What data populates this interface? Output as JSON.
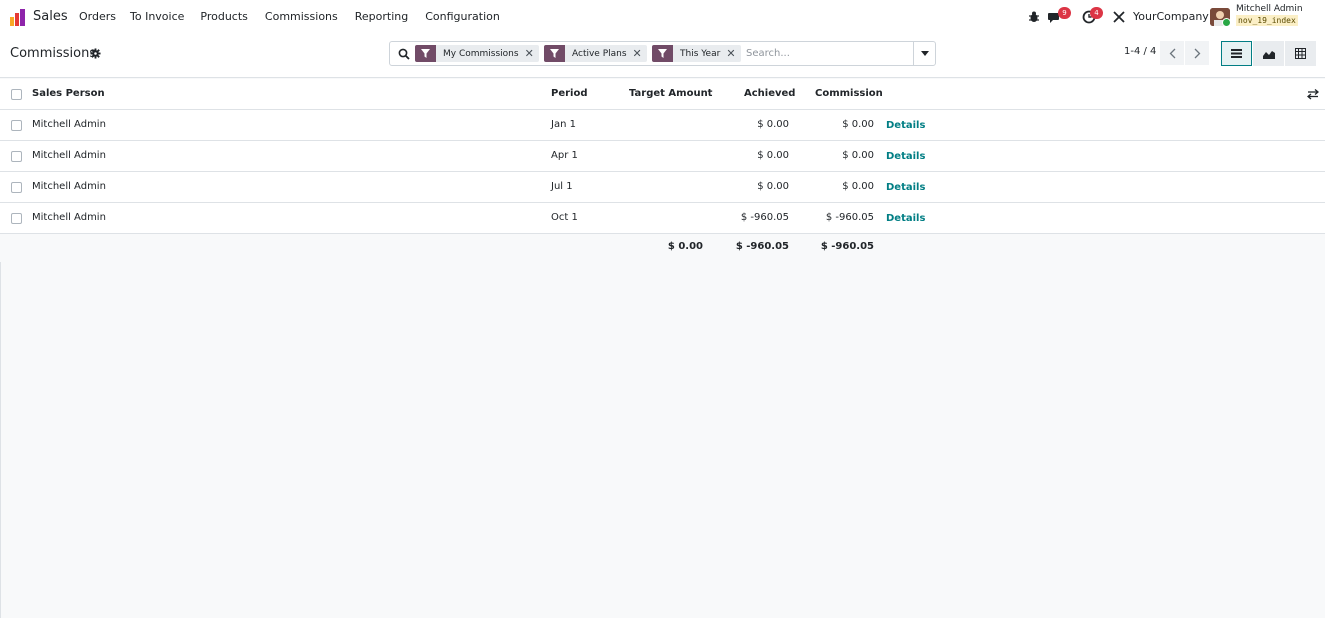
{
  "navbar": {
    "app_name": "Sales",
    "menu": [
      "Orders",
      "To Invoice",
      "Products",
      "Commissions",
      "Reporting",
      "Configuration"
    ],
    "messages_count": "9",
    "activities_count": "4",
    "company": "YourCompany",
    "user_name": "Mitchell Admin",
    "db_name": "nov_19_index",
    "brand_color": "#714b67"
  },
  "control_panel": {
    "title": "Commissions",
    "facets": [
      {
        "label": "My Commissions"
      },
      {
        "label": "Active Plans"
      },
      {
        "label": "This Year"
      }
    ],
    "search_placeholder": "Search...",
    "pager": "1-4 / 4",
    "views": [
      "list",
      "graph",
      "pivot"
    ],
    "active_view": "list"
  },
  "table": {
    "columns": [
      "Sales Person",
      "Period",
      "Target Amount",
      "Achieved",
      "Commission"
    ],
    "rows": [
      {
        "sales_person": "Mitchell Admin",
        "period": "Jan 1",
        "target": "",
        "achieved": "$ 0.00",
        "commission": "$ 0.00",
        "action": "Details"
      },
      {
        "sales_person": "Mitchell Admin",
        "period": "Apr 1",
        "target": "",
        "achieved": "$ 0.00",
        "commission": "$ 0.00",
        "action": "Details"
      },
      {
        "sales_person": "Mitchell Admin",
        "period": "Jul 1",
        "target": "",
        "achieved": "$ 0.00",
        "commission": "$ 0.00",
        "action": "Details"
      },
      {
        "sales_person": "Mitchell Admin",
        "period": "Oct 1",
        "target": "",
        "achieved": "$ -960.05",
        "commission": "$ -960.05",
        "action": "Details"
      }
    ],
    "totals": {
      "target": "$ 0.00",
      "achieved": "$ -960.05",
      "commission": "$ -960.05"
    }
  },
  "colors": {
    "accent": "#017e84",
    "badge": "#dc3545",
    "online": "#28a745"
  }
}
